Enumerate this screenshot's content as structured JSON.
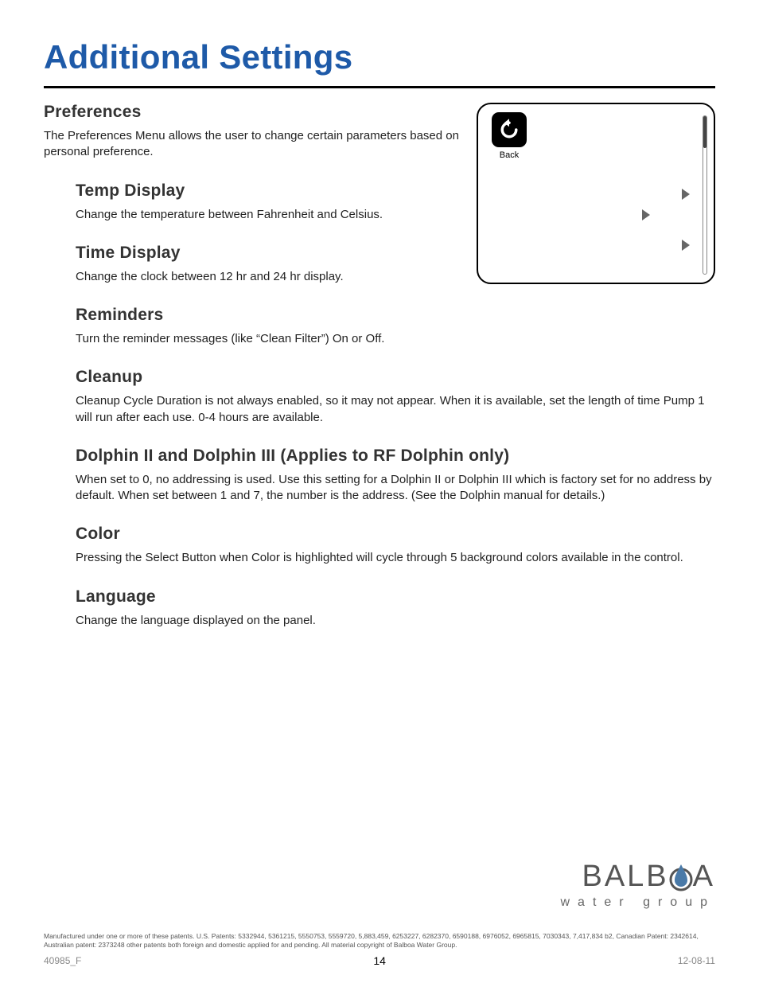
{
  "title": "Additional Settings",
  "preferences": {
    "heading": "Preferences",
    "body": "The Preferences Menu allows the user to change certain parameters based on personal preference."
  },
  "sections": [
    {
      "heading": "Temp Display",
      "body": "Change the temperature between Fahrenheit and Celsius."
    },
    {
      "heading": "Time Display",
      "body": "Change the clock between 12 hr and 24 hr display."
    },
    {
      "heading": "Reminders",
      "body": "Turn the reminder messages (like “Clean Filter”) On or Off."
    },
    {
      "heading": "Cleanup",
      "body": "Cleanup Cycle Duration is not always enabled, so it may not appear. When it is available, set the length of time Pump 1 will run after each use. 0-4 hours are available."
    },
    {
      "heading": "Dolphin II and Dolphin III   (Applies to RF Dolphin only)",
      "body": "When set to 0, no addressing is used. Use this setting for a Dolphin II or Dolphin III which is factory set for no address by default. When set between 1 and 7, the number is the address. (See the Dolphin manual for details.)"
    },
    {
      "heading": "Color",
      "body": "Pressing the Select Button when Color is highlighted will cycle through 5 background colors available in the control."
    },
    {
      "heading": "Language",
      "body": "Change the language displayed on the panel."
    }
  ],
  "screen": {
    "back_label": "Back"
  },
  "logo": {
    "brand_left": "BALB",
    "brand_right": "A",
    "tagline": "water group"
  },
  "legal": "Manufactured under one or more of these patents.  U.S. Patents: 5332944, 5361215, 5550753, 5559720, 5,883,459, 6253227, 6282370, 6590188, 6976052, 6965815, 7030343, 7,417,834 b2, Canadian Patent: 2342614, Australian patent: 2373248 other patents both foreign and domestic applied for and pending.   All material copyright of Balboa Water Group.",
  "doc_id": "40985_F",
  "page_number": "14",
  "doc_date": "12-08-11"
}
